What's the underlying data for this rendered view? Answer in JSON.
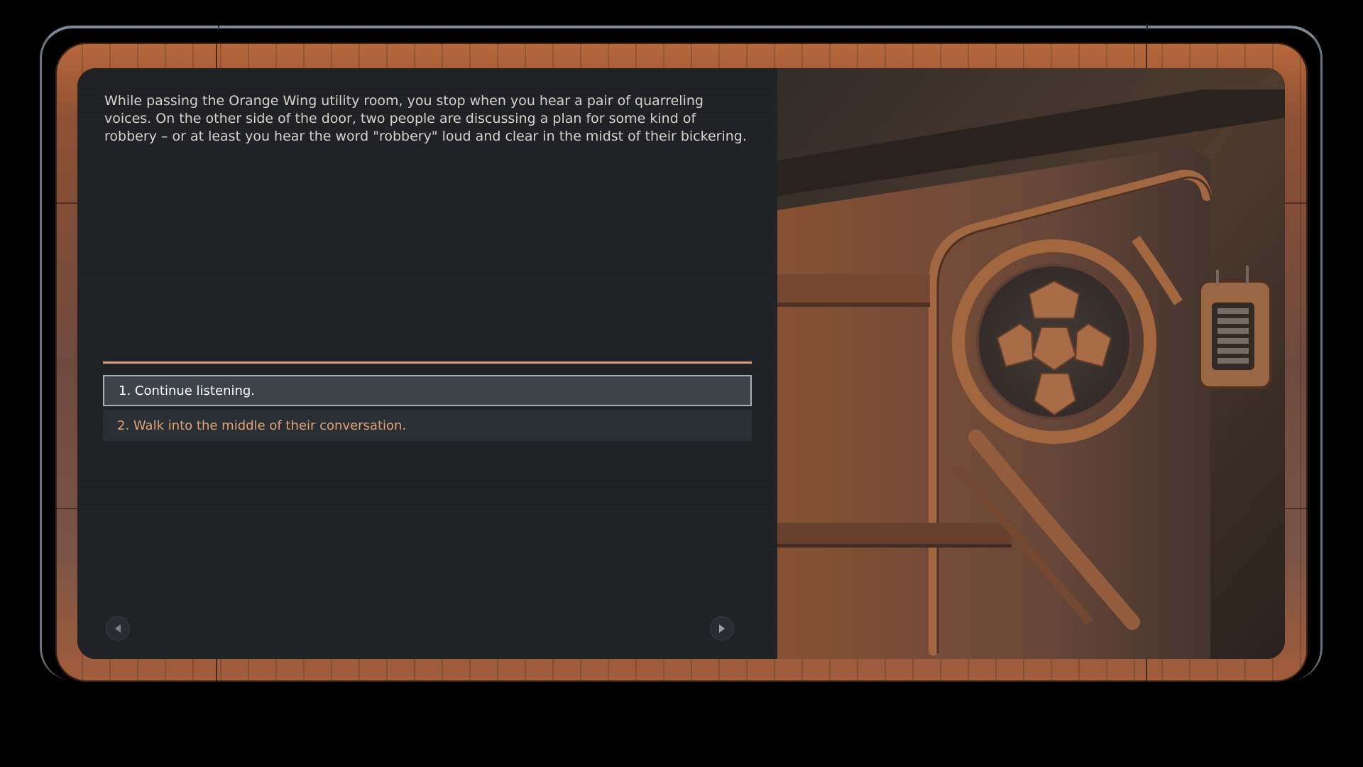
{
  "event": {
    "description": "While passing the Orange Wing utility room, you stop when you hear a pair of quarreling voices. On the other side of the door, two people are discussing a plan for some kind of robbery – or at least you hear the word \"robbery\" loud and clear in the midst of their bickering.",
    "choices": [
      {
        "label": "1. Continue listening.",
        "state": "selected"
      },
      {
        "label": "2. Walk into the middle of their conversation.",
        "state": "default"
      }
    ]
  },
  "navigation": {
    "prev_icon": "triangle-left-icon",
    "next_icon": "triangle-right-icon"
  },
  "illustration": {
    "subject": "copper-door-with-emblem-and-keypad"
  },
  "colors": {
    "accent": "#dca07a",
    "selected_text": "#ffffff",
    "choice_text": "#e0a179",
    "panel_bg": "#202125",
    "frame_copper": "#a35d3b"
  }
}
